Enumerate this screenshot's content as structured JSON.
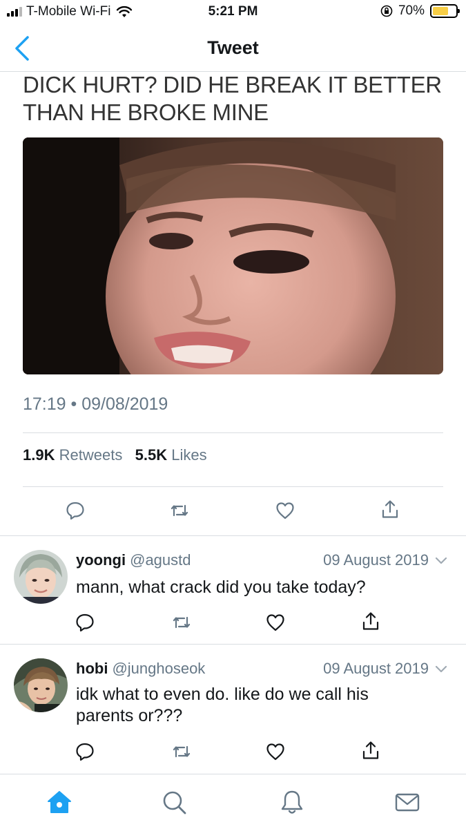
{
  "status_bar": {
    "carrier": "T-Mobile Wi-Fi",
    "time": "5:21 PM",
    "battery": "70%",
    "battery_level": 0.7
  },
  "nav": {
    "title": "Tweet"
  },
  "tweet": {
    "text": "DICK HURT? DID HE BREAK IT BETTER THAN HE BROKE MINE",
    "time": "17:19",
    "date": "09/08/2019",
    "retweet_count": "1.9K",
    "retweet_label": "Retweets",
    "like_count": "5.5K",
    "like_label": "Likes"
  },
  "replies": [
    {
      "name": "yoongi",
      "handle": "@agustd",
      "date": "09 August 2019",
      "text": "mann, what crack did you take today?"
    },
    {
      "name": "hobi",
      "handle": "@junghoseok",
      "date": "09 August 2019",
      "text": "idk what to even do. like do we call his parents or???"
    }
  ],
  "colors": {
    "accent": "#1da1f2",
    "icon_gray": "#657786",
    "divider": "#d9dde1",
    "battery": "#f7ce46"
  },
  "icons": {
    "back": "chevron-left-icon",
    "reply": "reply-icon",
    "retweet": "retweet-icon",
    "like": "heart-icon",
    "share": "share-icon",
    "tabs": [
      "home-icon",
      "search-icon",
      "notifications-icon",
      "messages-icon"
    ]
  }
}
